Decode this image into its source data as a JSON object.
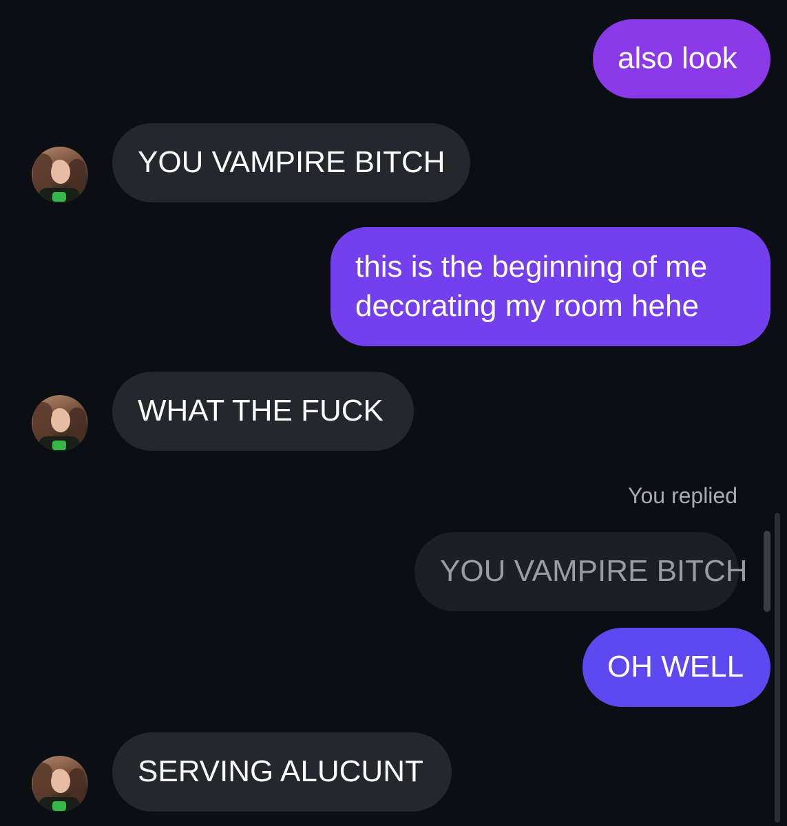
{
  "colors": {
    "background": "#0b0e13",
    "received_bubble": "#24272c",
    "quoted_bubble": "#1c1f23",
    "sent_gradient_top": "#8a3ae6",
    "sent_gradient_mid": "#7440ee",
    "sent_gradient_bottom": "#5e48f0"
  },
  "messages": [
    {
      "direction": "sent",
      "text": "also look"
    },
    {
      "direction": "received",
      "text": "YOU VAMPIRE BITCH",
      "avatar": "contact-avatar"
    },
    {
      "direction": "sent",
      "text": "this is the beginning of me decorating my room hehe"
    },
    {
      "direction": "received",
      "text": "WHAT THE FUCK",
      "avatar": "contact-avatar"
    },
    {
      "direction": "sent",
      "reply_label": "You replied",
      "quoted_text": "YOU VAMPIRE BITCH",
      "text": "OH WELL"
    },
    {
      "direction": "received",
      "text": "SERVING ALUCUNT",
      "avatar": "contact-avatar"
    }
  ]
}
